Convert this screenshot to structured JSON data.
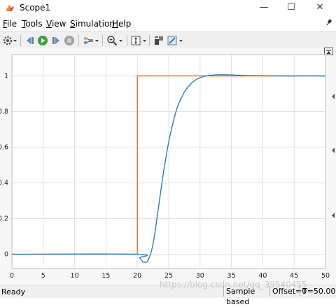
{
  "window": {
    "title": "Scope1",
    "minimize_glyph": "—",
    "maximize_glyph": "☐",
    "close_glyph": "✕"
  },
  "menubar": {
    "items": [
      {
        "underline": "F",
        "rest": "ile"
      },
      {
        "underline": "T",
        "rest": "ools"
      },
      {
        "underline": "V",
        "rest": "iew"
      },
      {
        "underline": "S",
        "rest": "imulation"
      },
      {
        "underline": "H",
        "rest": "elp"
      }
    ]
  },
  "toolbar": {
    "icons": [
      "settings-icon",
      "step-back-icon",
      "run-icon",
      "step-forward-icon",
      "stop-icon",
      "highlight-icon",
      "zoom-icon",
      "autoscale-icon",
      "cursor-measurements-icon",
      "style-icon"
    ]
  },
  "statusbar": {
    "ready": "Ready",
    "sample_based": "Sample based",
    "offset": "Offset=0",
    "time": "T=50.000"
  },
  "watermark": "https://blog.csdn.net/qq_39540455",
  "colors": {
    "step_series": "#e06c3a",
    "response_series": "#2e7fbf",
    "grid": "#e1e1e1",
    "axes_background": "#ffffff"
  },
  "chart_data": {
    "type": "line",
    "title": "",
    "xlabel": "",
    "ylabel": "",
    "xlim": [
      0,
      50
    ],
    "ylim": [
      -0.08,
      1.12
    ],
    "x_ticks": [
      0,
      5,
      10,
      15,
      20,
      25,
      30,
      35,
      40,
      45,
      50
    ],
    "y_ticks": [
      0,
      0.2,
      0.4,
      0.6,
      0.8,
      1
    ],
    "y_tick_labels": [
      "0",
      "0.2",
      "0.4",
      "0.6",
      "0.8",
      "1"
    ],
    "grid": true,
    "series": [
      {
        "color": "#e06c3a",
        "x": [
          0,
          20,
          20,
          50
        ],
        "y": [
          0,
          0,
          1,
          1
        ]
      },
      {
        "color": "#2e7fbf",
        "x": [
          0,
          20,
          20.4,
          20.8,
          21.2,
          21.6,
          22.0,
          22.4,
          22.8,
          23.2,
          23.6,
          24.0,
          24.5,
          25.0,
          25.5,
          26.0,
          26.5,
          27.0,
          27.5,
          28.0,
          28.5,
          29.0,
          29.5,
          30.0,
          30.5,
          31.0,
          31.5,
          32.0,
          33.0,
          34.0,
          35.0,
          36.0,
          37.0,
          38.0,
          40.0,
          43.0,
          46.0,
          50.0
        ],
        "y": [
          0,
          0,
          -0.02,
          -0.04,
          -0.045,
          -0.04,
          -0.01,
          0.04,
          0.12,
          0.22,
          0.32,
          0.42,
          0.53,
          0.63,
          0.71,
          0.78,
          0.835,
          0.875,
          0.91,
          0.935,
          0.955,
          0.97,
          0.982,
          0.99,
          0.996,
          1.0,
          1.003,
          1.005,
          1.007,
          1.007,
          1.006,
          1.004,
          1.003,
          1.002,
          1.001,
          1.0,
          1.0,
          1.0
        ]
      }
    ]
  }
}
